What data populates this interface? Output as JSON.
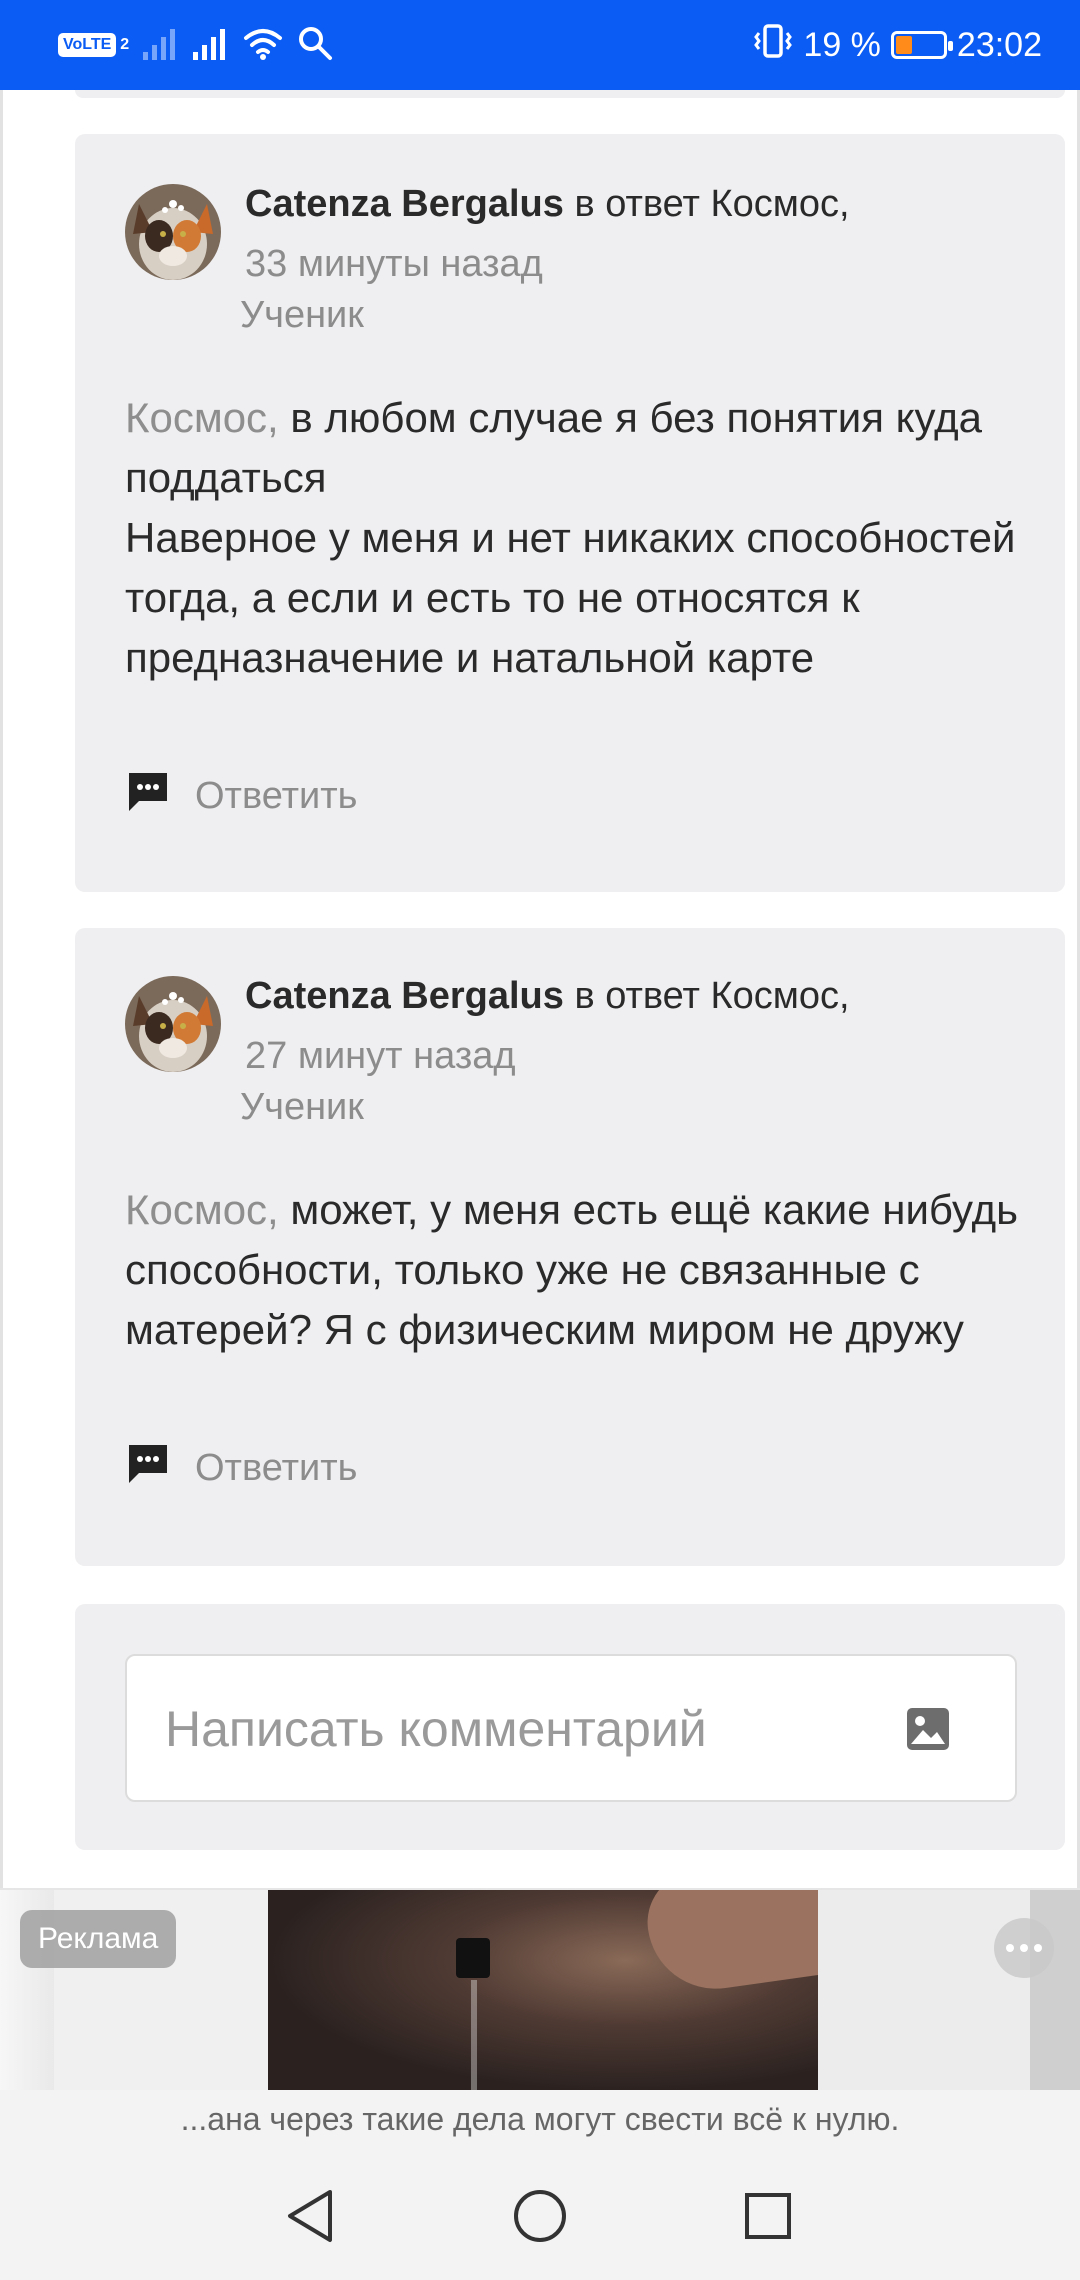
{
  "status_bar": {
    "volte_label": "VoLTE",
    "sim_index": "2",
    "battery_percent": "19 %",
    "time": "23:02",
    "battery_color": "#ff8c1a",
    "bar_color": "#0a5cf5"
  },
  "comments": [
    {
      "author": "Catenza Bergalus",
      "reply_to": "в ответ Космос,",
      "time": "33 минуты назад",
      "role": "Ученик",
      "mention": "Космос,",
      "text": " в любом случае я без понятия куда поддаться\nНаверное у меня и нет никаких способностей тогда, а если и есть то не относятся к предназначение и натальной карте",
      "reply_label": "Ответить"
    },
    {
      "author": "Catenza Bergalus",
      "reply_to": "в ответ Космос,",
      "time": "27 минут назад",
      "role": "Ученик",
      "mention": "Космос,",
      "text": " может, у меня есть ещё какие нибудь способности, только уже не связанные с матерей? Я с физическим миром не дружу",
      "reply_label": "Ответить"
    }
  ],
  "composer": {
    "placeholder": "Написать комментарий",
    "icon": "image-icon"
  },
  "ad": {
    "label": "Реклама",
    "ticker": "...ана через такие дела могут свести всё к нулю."
  },
  "nav": {
    "back_icon": "back-triangle-icon",
    "home_icon": "home-circle-icon",
    "recents_icon": "recents-square-icon"
  }
}
